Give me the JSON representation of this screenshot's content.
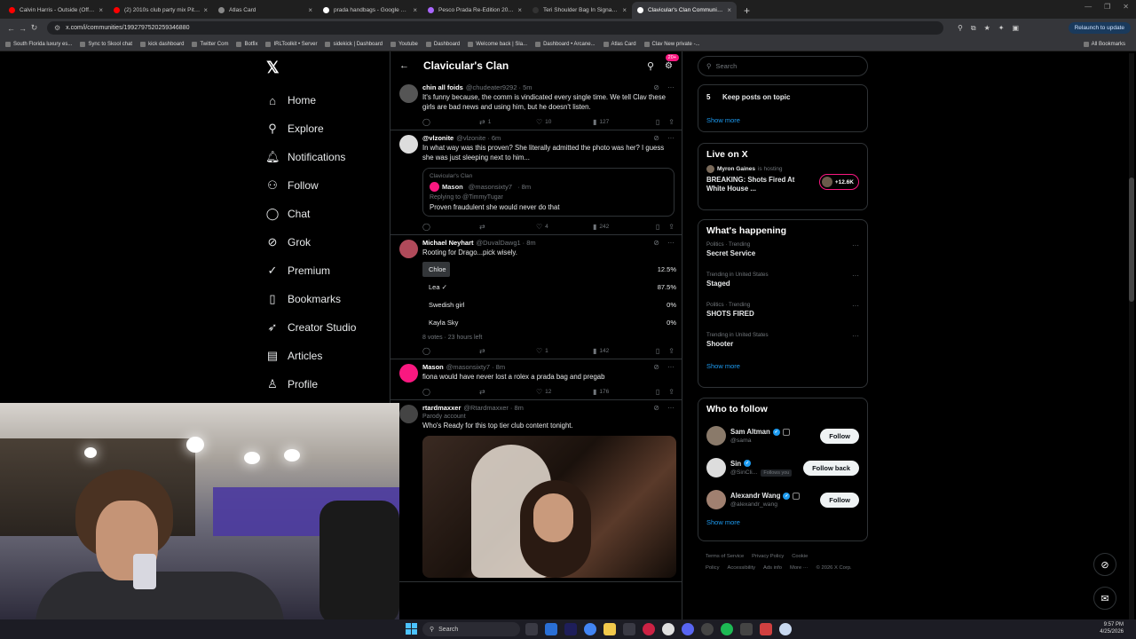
{
  "tabs": [
    {
      "label": "Calvin Harris - Outside (Official",
      "color": "#ff0000"
    },
    {
      "label": "(2) 2010s club party mix Pitbull",
      "color": "#ff0000"
    },
    {
      "label": "Atlas Card",
      "color": "#888888"
    },
    {
      "label": "prada handbags - Google Search",
      "color": "#ffffff"
    },
    {
      "label": "Pesco Prada Re-Edition 2005 Re",
      "color": "#aa66ff"
    },
    {
      "label": "Teri Shoulder Bag In Signature",
      "color": "#333333"
    },
    {
      "label": "Clavicular's Clan Community / X",
      "color": "#ffffff",
      "active": true
    }
  ],
  "address": {
    "url": "x.com/i/communities/1992797520259346880",
    "relaunch": "Relaunch to update"
  },
  "bookmarks": [
    "South Florida luxury es...",
    "Sync to Skool chat",
    "kick dashboard",
    "Twitter Com",
    "Botfix",
    "IRLToolkit • Server",
    "sidekick | Dashboard",
    "Youtube",
    "Dashboard",
    "Welcome back | Sla...",
    "Dashboard • Arcane...",
    "Atlas Card",
    "Clav New private -..."
  ],
  "bookmarks_right": "All Bookmarks",
  "nav": [
    {
      "label": "Home",
      "icon": "home-icon",
      "glyph": "⌂"
    },
    {
      "label": "Explore",
      "icon": "search-icon",
      "glyph": "⚲"
    },
    {
      "label": "Notifications",
      "icon": "bell-icon",
      "glyph": "🔔︎"
    },
    {
      "label": "Follow",
      "icon": "person-plus-icon",
      "glyph": "⚇"
    },
    {
      "label": "Chat",
      "icon": "chat-icon",
      "glyph": "◯"
    },
    {
      "label": "Grok",
      "icon": "grok-icon",
      "glyph": "⊘"
    },
    {
      "label": "Premium",
      "icon": "premium-icon",
      "glyph": "✓"
    },
    {
      "label": "Bookmarks",
      "icon": "bookmark-icon",
      "glyph": "▯"
    },
    {
      "label": "Creator Studio",
      "icon": "rocket-icon",
      "glyph": "➶"
    },
    {
      "label": "Articles",
      "icon": "article-icon",
      "glyph": "▤"
    },
    {
      "label": "Profile",
      "icon": "profile-icon",
      "glyph": "♙"
    }
  ],
  "community": {
    "title": "Clavicular's Clan",
    "badge": "20+"
  },
  "posts": [
    {
      "name": "chin all foids",
      "handle": "@chudeater9292",
      "time": "· 5m",
      "text": "It's funny because, the comm is vindicated every single time. We tell Clav these girls are bad news and using him, but he doesn't listen.",
      "replies": "",
      "reposts": "1",
      "likes": "10",
      "views": "127",
      "avatar": "#555555"
    },
    {
      "name": "@vlzonite",
      "handle": "@vlzonite",
      "time": "· 6m",
      "text": "In what way was this proven? She literally admitted the photo was her? I guess she was just sleeping next to him...",
      "replies": "",
      "reposts": "",
      "likes": "4",
      "views": "242",
      "avatar": "#dddddd",
      "quote": {
        "community": "Clavicular's Clan",
        "name": "Mason",
        "handle": "@masonsixty7",
        "time": "· 8m",
        "reply": "Replying to @TimmyTugar",
        "text": "Proven fraudulent she would never do that"
      }
    },
    {
      "name": "Michael Neyhart",
      "handle": "@DuvalDawg1",
      "time": "· 8m",
      "text": "Rooting for Drago...pick wisely.",
      "replies": "",
      "reposts": "",
      "likes": "1",
      "views": "142",
      "avatar": "#b04a5a",
      "poll": {
        "options": [
          {
            "label": "Chloe",
            "pct": "12.5%",
            "value": 0.125
          },
          {
            "label": "Lea ✓",
            "pct": "87.5%",
            "value": 0.875,
            "winner": true
          },
          {
            "label": "Swedish girl",
            "pct": "0%",
            "value": 0
          },
          {
            "label": "Kayla Sky",
            "pct": "0%",
            "value": 0
          }
        ],
        "meta": "8 votes · 23 hours left"
      }
    },
    {
      "name": "Mason",
      "handle": "@masonsixty7",
      "time": "· 8m",
      "text": "fiona would have never lost a rolex a prada bag and pregab",
      "replies": "",
      "reposts": "",
      "likes": "12",
      "views": "176",
      "avatar": "#f91880"
    },
    {
      "name": "rtardmaxxer",
      "handle": "@Rtardmaxxer",
      "time": "· 8m",
      "parody": "Parody account",
      "text": "Who's Ready for this top tier club content tonight.",
      "avatar": "#444444"
    }
  ],
  "right": {
    "search_placeholder": "Search",
    "rule": {
      "num": "5",
      "text": "Keep posts on topic"
    },
    "show_more": "Show more",
    "live_title": "Live on X",
    "live": {
      "host": "Myron Gaines",
      "hosting": "is hosting",
      "title": "BREAKING: Shots Fired At White House ...",
      "count": "+12.6K"
    },
    "happening_title": "What's happening",
    "trends": [
      {
        "cat": "Politics · Trending",
        "name": "Secret Service"
      },
      {
        "cat": "Trending in United States",
        "name": "Staged"
      },
      {
        "cat": "Politics · Trending",
        "name": "SHOTS FIRED"
      },
      {
        "cat": "Trending in United States",
        "name": "Shooter"
      }
    ],
    "wtf_title": "Who to follow",
    "wtf": [
      {
        "name": "Sam Altman",
        "handle": "@sama",
        "btn": "Follow",
        "avatar": "#8a7a6a"
      },
      {
        "name": "Sin",
        "handle": "@SinCli...",
        "tag": "Follows you",
        "btn": "Follow back",
        "avatar": "#dddddd"
      },
      {
        "name": "Alexandr Wang",
        "handle": "@alexandr_wang",
        "btn": "Follow",
        "avatar": "#a08070"
      }
    ],
    "footer": [
      "Terms of Service",
      "Privacy Policy",
      "Cookie Policy",
      "Accessibility",
      "Ads info",
      "More ···",
      "© 2026 X Corp."
    ]
  },
  "taskbar": {
    "search": "Search",
    "time": "9:57 PM",
    "date": "4/25/2026"
  }
}
